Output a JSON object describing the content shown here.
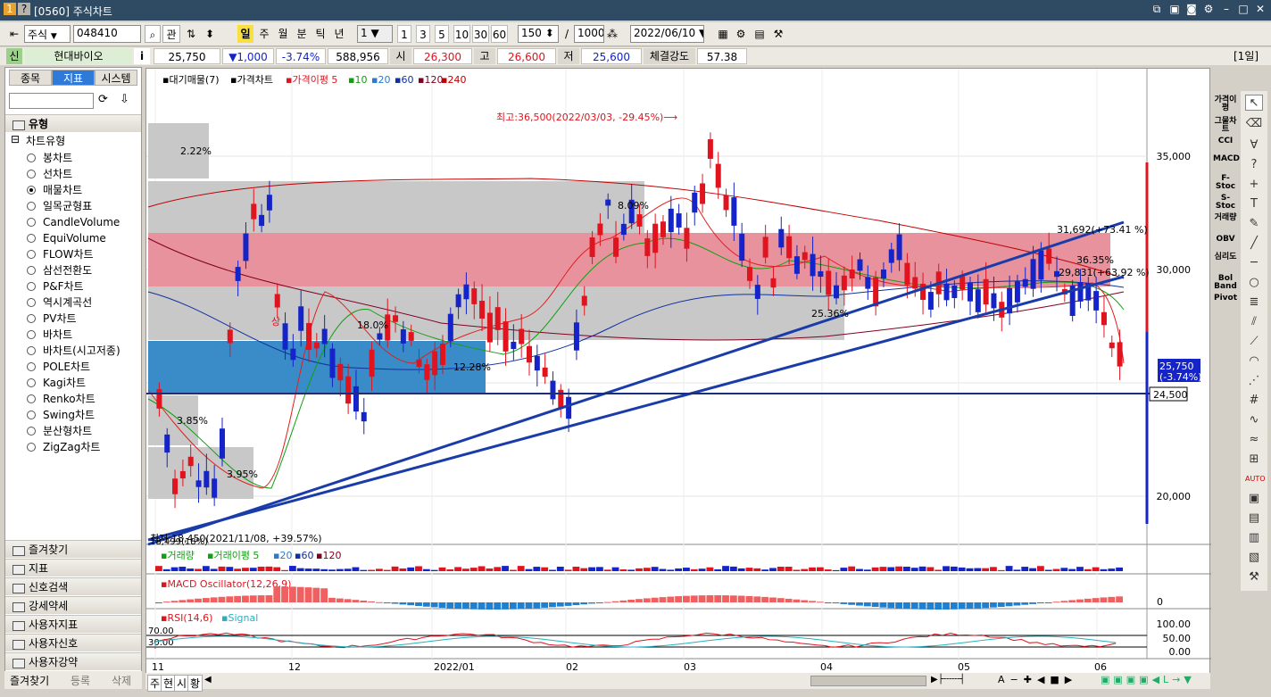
{
  "window": {
    "title": "[0560] 주식차트",
    "badge1": "1",
    "badge2": "?"
  },
  "toolbar": {
    "market": "주식",
    "code": "048410",
    "gwan": "관",
    "periods": [
      "일",
      "주",
      "월",
      "분",
      "틱",
      "년"
    ],
    "unit_select": "1",
    "minute_btns": [
      "1",
      "3",
      "5",
      "10",
      "30",
      "60"
    ],
    "count": "150",
    "slash": "/",
    "total": "1000",
    "date": "2022/06/10"
  },
  "pricebar": {
    "sin": "신",
    "name": "현대바이오",
    "info": "i",
    "price": "25,750",
    "change": "▼1,000",
    "change_pct": "-3.74%",
    "volume": "588,956",
    "open_label": "시",
    "open": "26,300",
    "high_label": "고",
    "high": "26,600",
    "low_label": "저",
    "low": "25,600",
    "strength_label": "체결강도",
    "strength": "57.38",
    "period_tag": "[1일]"
  },
  "left": {
    "tabs": [
      "종목",
      "지표",
      "시스템"
    ],
    "section": "유형",
    "group": "차트유형",
    "types": [
      "봉차트",
      "선차트",
      "매물차트",
      "일목균형표",
      "CandleVolume",
      "EquiVolume",
      "FLOW차트",
      "삼선전환도",
      "P&F차트",
      "역시계곡선",
      "PV차트",
      "바차트",
      "바차트(시고저종)",
      "POLE차트",
      "Kagi차트",
      "Renko차트",
      "Swing차트",
      "분산형차트",
      "ZigZag차트"
    ],
    "selected_type": "매물차트",
    "folders": [
      "즐겨찾기",
      "지표",
      "신호검색",
      "강세약세",
      "사용자지표",
      "사용자신호",
      "사용자강약"
    ],
    "bottom": [
      "즐겨찾기",
      "등록",
      "삭제"
    ]
  },
  "chart": {
    "legend": {
      "a": "대기매물(7)",
      "b": "가격차트",
      "c": "가격이평 5",
      "ma": [
        "10",
        "20",
        "60",
        "120",
        "240"
      ]
    },
    "annotations": {
      "high": "최고:36,500(2022/03/03, -29.45%)⟶",
      "low": "최저:18,450(2021/11/08, +39.57%)",
      "tl1": "31,692(+73.41 %)",
      "tl2": "29,831(+63.92 %)",
      "tl3": "36.35%",
      "pct_a": "2.22%",
      "pct_b": "8.09%",
      "pct_c": "25.36%",
      "pct_d": "12.28%",
      "pct_e": "3.85%",
      "pct_f": "3.95%",
      "pct_g": "18.0%",
      "pct_h": "18,499(18%)",
      "sang": "상"
    },
    "yaxis": [
      "35,000",
      "30,000",
      "20,000"
    ],
    "cur_price": "25,750",
    "cur_pct": "(-3.74%)",
    "support": "24,500",
    "volume_legend": {
      "a": "거래량",
      "b": "거래이평 5",
      "c": [
        "20",
        "60",
        "120"
      ]
    },
    "macd_legend": "MACD Oscillator(12,26,9)",
    "macd_zero": "0",
    "rsi_legend": {
      "a": "RSI(14,6)",
      "b": "Signal"
    },
    "rsi_levels": {
      "l70": "70.00",
      "l30": "30.00"
    },
    "rsi_axis": [
      "100.00",
      "50.00",
      "0.00"
    ],
    "xaxis": [
      "11",
      "12",
      "2022/01",
      "02",
      "03",
      "04",
      "05",
      "06"
    ],
    "colors": {
      "up": "#e0141e",
      "down": "#1424c8",
      "zone_red": "#e8929e",
      "zone_blue": "#3a8cc8",
      "zone_gray": "#c8c8c8",
      "trend": "#1a3ca8"
    }
  },
  "bottom_tabs": [
    "주",
    "현",
    "시",
    "황"
  ],
  "right_labels": [
    "가격이평",
    "그물차트",
    "CCI",
    "MACD",
    "F-Stoc",
    "S-Stoc",
    "거래량",
    "OBV",
    "심리도",
    "Bol Band",
    "Pivot"
  ]
}
